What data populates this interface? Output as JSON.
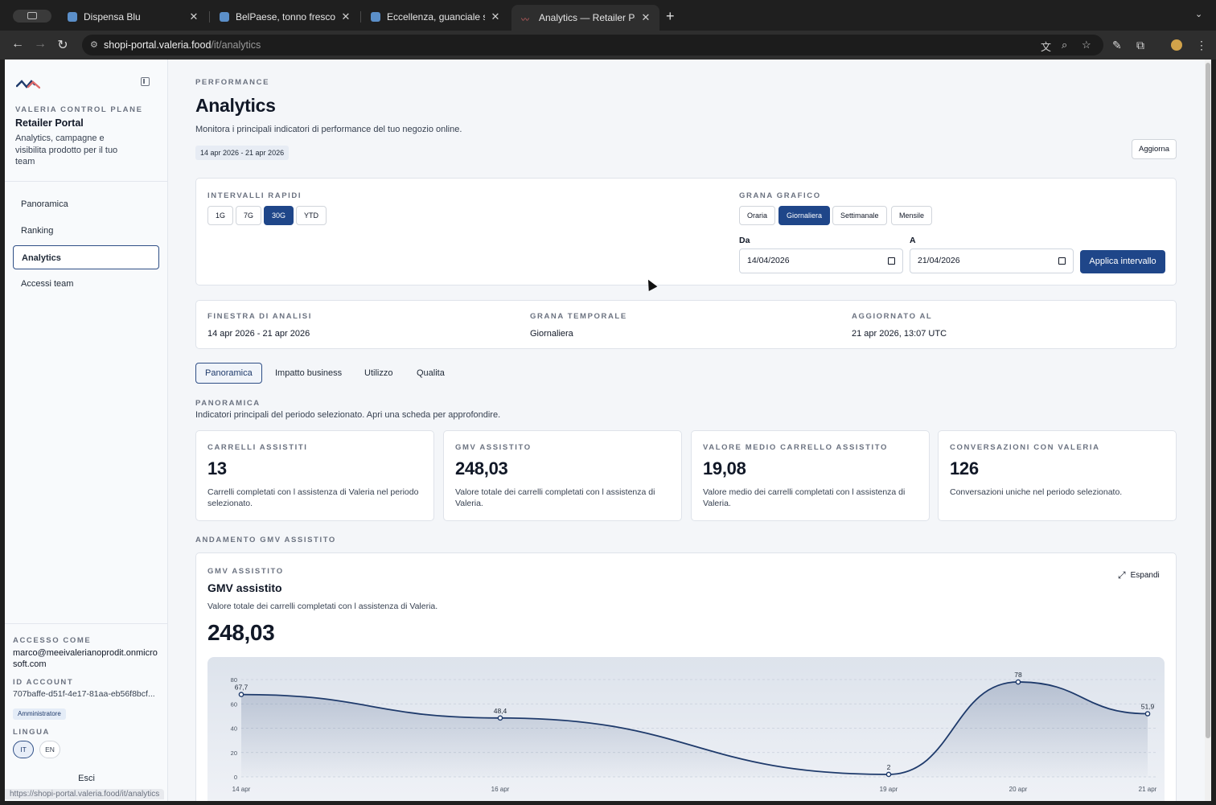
{
  "browser": {
    "tabs": [
      {
        "title": "Dispensa Blu"
      },
      {
        "title": "BelPaese, tonno fresco a tran"
      },
      {
        "title": "Eccellenza, guanciale stagion"
      },
      {
        "title": "Analytics — Retailer Portal"
      }
    ],
    "url_host": "shopi-portal.valeria.food",
    "url_path": "/it/analytics",
    "status_url": "https://shopi-portal.valeria.food/it/analytics"
  },
  "sidebar": {
    "eyebrow": "VALERIA CONTROL PLANE",
    "title": "Retailer Portal",
    "description": "Analytics, campagne e visibilita prodotto per il tuo team",
    "nav": [
      {
        "label": "Panoramica"
      },
      {
        "label": "Ranking"
      },
      {
        "label": "Analytics"
      },
      {
        "label": "Accessi team"
      }
    ],
    "access_label": "ACCESSO COME",
    "email": "marco@meeivalerianoprodit.onmicrosoft.com",
    "account_label": "ID ACCOUNT",
    "account_id": "707baffe-d51f-4e17-81aa-eb56f8bcf...",
    "role": "Amministratore",
    "language_label": "LINGUA",
    "languages": [
      "IT",
      "EN"
    ],
    "logout": "Esci"
  },
  "header": {
    "eyebrow": "PERFORMANCE",
    "title": "Analytics",
    "subtitle": "Monitora i principali indicatori di performance del tuo negozio online.",
    "range": "14 apr 2026 - 21 apr 2026",
    "refresh": "Aggiorna"
  },
  "filters": {
    "quick_label": "INTERVALLI RAPIDI",
    "quick": [
      "1G",
      "7G",
      "30G",
      "YTD"
    ],
    "grain_label": "GRANA GRAFICO",
    "grains": [
      "Oraria",
      "Giornaliera",
      "Settimanale",
      "Mensile"
    ],
    "from_label": "Da",
    "from_value": "14/04/2026",
    "to_label": "A",
    "to_value": "21/04/2026",
    "apply": "Applica intervallo"
  },
  "info": {
    "window_label": "FINESTRA DI ANALISI",
    "window_value": "14 apr 2026 - 21 apr 2026",
    "grain_label": "GRANA TEMPORALE",
    "grain_value": "Giornaliera",
    "updated_label": "AGGIORNATO AL",
    "updated_value": "21 apr 2026, 13:07 UTC"
  },
  "page_tabs": [
    "Panoramica",
    "Impatto business",
    "Utilizzo",
    "Qualita"
  ],
  "overview": {
    "eyebrow": "PANORAMICA",
    "description": "Indicatori principali del periodo selezionato. Apri una scheda per approfondire."
  },
  "kpis": [
    {
      "label": "CARRELLI ASSISTITI",
      "value": "13",
      "desc": "Carrelli completati con l assistenza di Valeria nel periodo selezionato."
    },
    {
      "label": "GMV ASSISTITO",
      "value": "248,03",
      "desc": "Valore totale dei carrelli completati con l assistenza di Valeria."
    },
    {
      "label": "VALORE MEDIO CARRELLO ASSISTITO",
      "value": "19,08",
      "desc": "Valore medio dei carrelli completati con l assistenza di Valeria."
    },
    {
      "label": "CONVERSAZIONI CON VALERIA",
      "value": "126",
      "desc": "Conversazioni uniche nel periodo selezionato."
    }
  ],
  "trend": {
    "section_label": "ANDAMENTO GMV ASSISTITO",
    "eyebrow": "GMV ASSISTITO",
    "title": "GMV assistito",
    "description": "Valore totale dei carrelli completati con l assistenza di Valeria.",
    "value": "248,03",
    "expand": "Espandi"
  },
  "colors": {
    "accent": "#1f4689",
    "line": "#1e3a6b"
  },
  "chart_data": {
    "type": "area",
    "title": "",
    "x": [
      "14 apr",
      "16 apr",
      "19 apr",
      "20 apr",
      "21 apr"
    ],
    "x_day": [
      14,
      16,
      19,
      20,
      21
    ],
    "series": [
      {
        "values": [
          67.7,
          48.4,
          2,
          78,
          51.9
        ],
        "labels": [
          "67,7",
          "48,4",
          "2",
          "78",
          "51,9"
        ]
      }
    ],
    "y_ticks": [
      0,
      20,
      40,
      60,
      80
    ],
    "ylim": [
      0,
      80
    ],
    "grid": true
  }
}
